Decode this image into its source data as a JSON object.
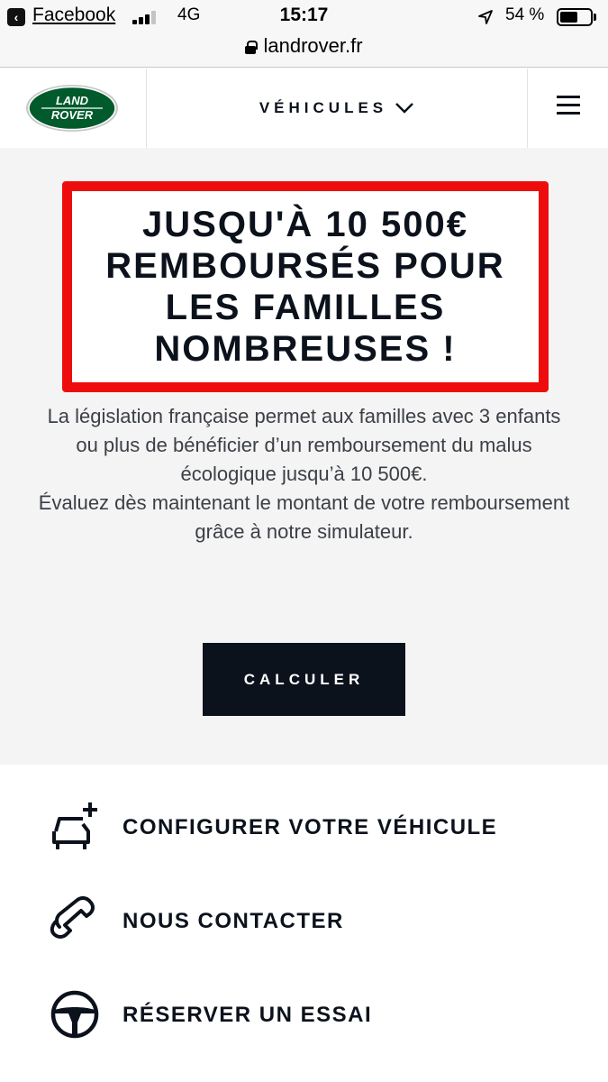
{
  "status_bar": {
    "back_app": "Facebook",
    "network": "4G",
    "time": "15:17",
    "battery": "54 %"
  },
  "browser": {
    "url": "landrover.fr"
  },
  "header": {
    "logo_text_line1": "LAND",
    "logo_text_line2": "ROVER",
    "nav_label": "VÉHICULES",
    "brand_color": "#005a2b"
  },
  "hero": {
    "promo_title": "JUSQU'À 10 500€ REMBOURSÉS POUR LES FAMILLES NOMBREUSES !",
    "paragraph1": "La législation française permet aux familles avec 3 enfants ou plus de bénéficier d’un remboursement du malus écologique jusqu’à 10 500€.",
    "paragraph2": "Évaluez dès maintenant le montant de votre remboursement grâce à notre simulateur.",
    "cta_label": "CALCULER",
    "accent_color": "#ee0d0d"
  },
  "actions": [
    {
      "label": "CONFIGURER VOTRE VÉHICULE",
      "icon": "car-configure-icon"
    },
    {
      "label": "NOUS CONTACTER",
      "icon": "phone-icon"
    },
    {
      "label": "RÉSERVER UN ESSAI",
      "icon": "steering-wheel-icon"
    }
  ]
}
